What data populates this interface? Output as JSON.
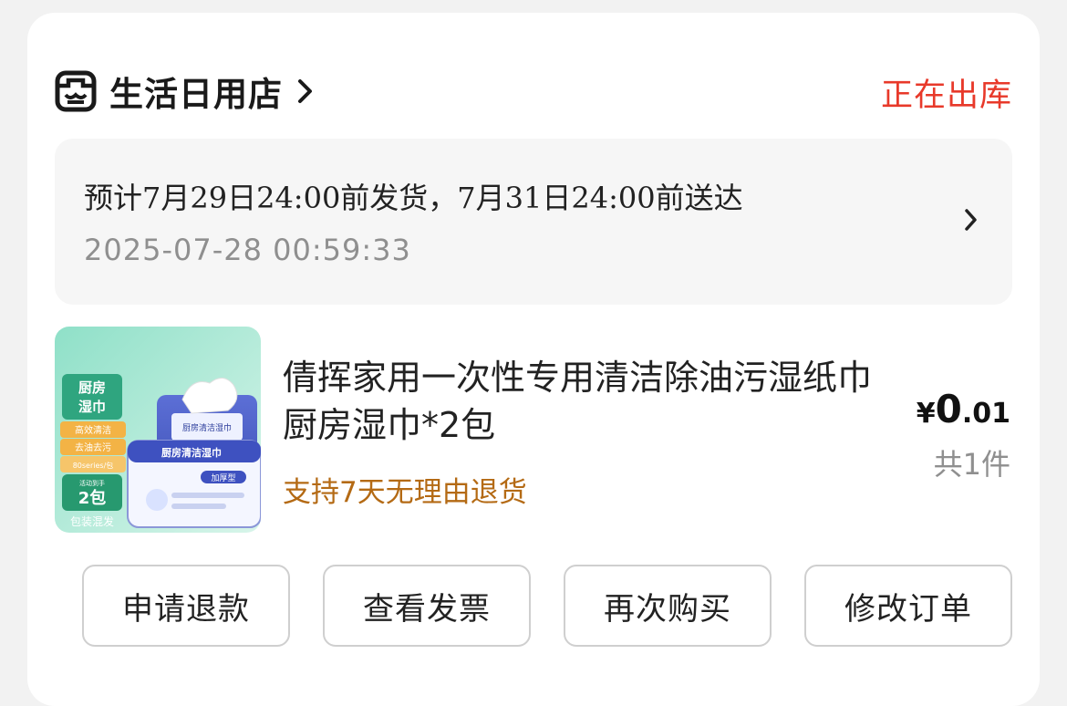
{
  "store": {
    "name": "生活日用店",
    "status": "正在出库",
    "status_color": "#e8392a",
    "icon": "store-face-icon"
  },
  "delivery": {
    "text": "预计7月29日24:00前发货，7月31日24:00前送达",
    "time": "2025-07-28 00:59:33"
  },
  "product": {
    "title": "倩挥家用一次性专用清洁除油污湿纸巾 厨房湿巾*2包",
    "return_policy": "支持7天无理由退货",
    "price_symbol": "¥",
    "price_int": "0",
    "price_dec": ".01",
    "quantity": "共1件",
    "image": {
      "tag_title": "厨房湿巾",
      "tag_lines": [
        "高效清洁",
        "去油去污",
        "80series/包"
      ],
      "promo_small": "活动到手",
      "promo_big": "2包",
      "promo_bottom": "包装混发",
      "pack_label": "厨房清洁湿巾",
      "pack_badge": "加厚型"
    }
  },
  "actions": [
    {
      "label": "申请退款"
    },
    {
      "label": "查看发票"
    },
    {
      "label": "再次购买"
    },
    {
      "label": "修改订单"
    }
  ]
}
